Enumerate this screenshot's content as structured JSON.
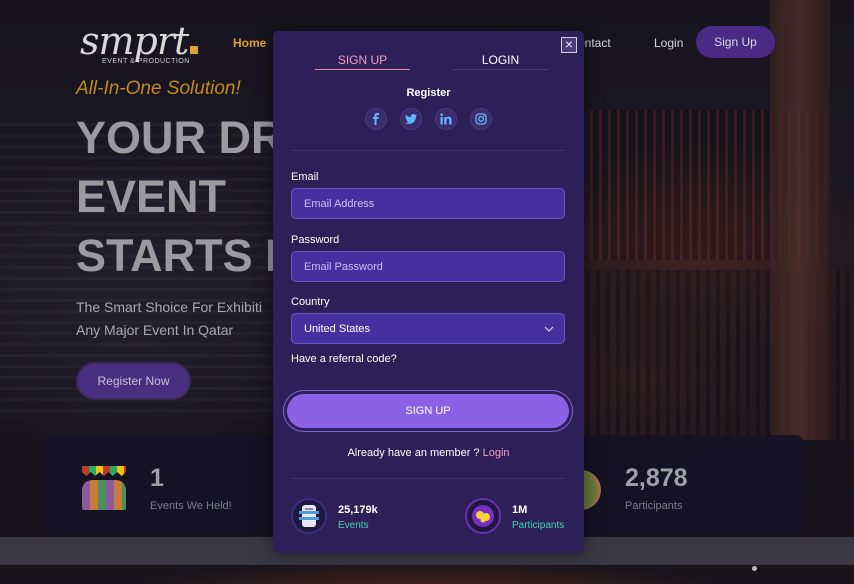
{
  "brand": {
    "logo_text": "smprt",
    "logo_sub": "EVENT & PRODUCTION"
  },
  "nav": {
    "home": "Home",
    "contact": "ontact",
    "login": "Login",
    "signup": "Sign Up"
  },
  "hero": {
    "kicker": "All-In-One Solution!",
    "title_lines": [
      "YOUR DR",
      "EVENT",
      "STARTS H"
    ],
    "subtitle_lines": [
      "The Smart Shoice For Exhibiti",
      "Any Major Event In Qatar"
    ],
    "cta": "Register Now"
  },
  "stats": [
    {
      "value": "1",
      "label": "Events We Held!",
      "icon": "crowd-icon"
    },
    {
      "value": "2,878",
      "label": "Participants",
      "icon": "participants-icon"
    }
  ],
  "modal": {
    "close_symbol": "×",
    "tabs": [
      "SIGN UP",
      "LOGIN"
    ],
    "active_tab": "SIGN UP",
    "register_title": "Register",
    "socials": [
      "facebook-icon",
      "twitter-icon",
      "linkedin-icon",
      "instagram-icon"
    ],
    "email": {
      "label": "Email",
      "placeholder": "Email Address"
    },
    "password": {
      "label": "Password",
      "placeholder": "Email Password"
    },
    "country": {
      "label": "Country",
      "value": "United States"
    },
    "referral": "Have a referral code?",
    "submit": "SIGN UP",
    "already_text": "Already have an member ? ",
    "already_link": "Login",
    "stats": [
      {
        "value": "25,179k",
        "label": "Events"
      },
      {
        "value": "1M",
        "label": "Participants"
      }
    ]
  },
  "colors": {
    "modal_bg": "#2d2058",
    "field_bg": "#4530a0",
    "accent_pink": "#f1a0c0",
    "button_purple": "#8b62e6",
    "stat_label_teal": "#44d4b0",
    "hero_gold": "#c48a1c"
  }
}
